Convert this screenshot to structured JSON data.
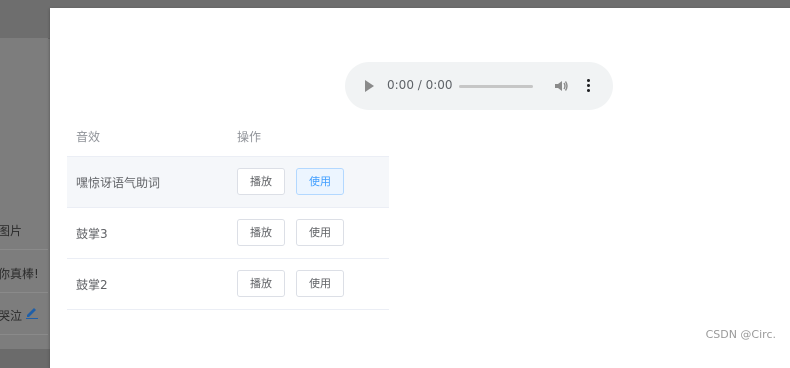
{
  "background": {
    "rows": [
      {
        "label": "图片"
      },
      {
        "label": "你真棒!"
      },
      {
        "label": "哭泣"
      }
    ]
  },
  "audio_player": {
    "time": "0:00 / 0:00",
    "progress": 0
  },
  "table": {
    "headers": {
      "name": "音效",
      "action": "操作"
    },
    "rows": [
      {
        "name": "嘿惊讶语气助词",
        "play_label": "播放",
        "use_label": "使用",
        "highlighted": true
      },
      {
        "name": "鼓掌3",
        "play_label": "播放",
        "use_label": "使用",
        "highlighted": false
      },
      {
        "name": "鼓掌2",
        "play_label": "播放",
        "use_label": "使用",
        "highlighted": false
      }
    ]
  },
  "watermark": "CSDN @Circ.",
  "colors": {
    "accent": "#409eff",
    "accent_bg": "#ecf5ff",
    "overlay": "#7a7a7a"
  }
}
